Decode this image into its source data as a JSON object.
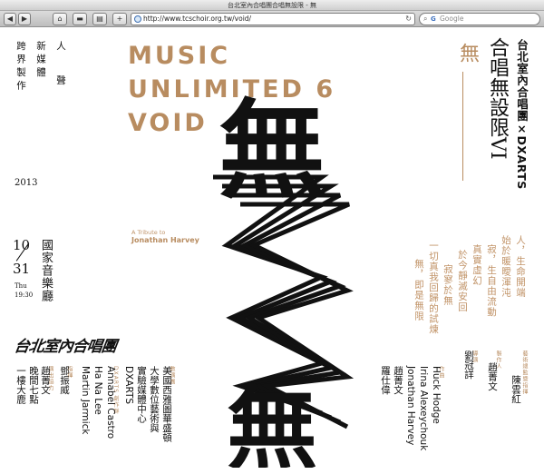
{
  "window": {
    "title": "台北室內合唱團合唱無設限 - 無"
  },
  "toolbar": {
    "back": "◀",
    "forward": "▶",
    "home": "⌂",
    "minimize": "▬",
    "bookmarks": "▤",
    "add": "+",
    "url": "http://www.tcschoir.org.tw/void/",
    "reload": "↻",
    "search_placeholder": "Google",
    "search_brand": "G"
  },
  "poster": {
    "headline_lines": [
      "MUSIC",
      "UNLIMITED 6",
      "VOID"
    ],
    "tribute": "A Tribute to",
    "tribute_name": "Jonathan Harvey",
    "left_verse": [
      "人",
      "新媒體",
      "聲",
      "跨界製作"
    ],
    "year": "2013",
    "date_month": "10",
    "date_day": "31",
    "weekday": "Thu",
    "time": "19:30",
    "venue": "國家音樂廳",
    "choir_logo": "台北室內合唱團",
    "big_char": "無",
    "side_mark": "無",
    "main_title": "合唱無設限VI",
    "presenter": "台北室內合唱團×DXARTS",
    "poem_lines": [
      "人，生命開端",
      "始於暖曖渾沌",
      "寂，生自由流動",
      "真實虛幻",
      "於今靜滅安回",
      "寂寥於無",
      "一切真我回歸的試煉",
      "無，即是無限"
    ]
  },
  "credits": {
    "left": [
      {
        "role": "",
        "names": [
          "一樓大鹿"
        ]
      },
      {
        "role": "",
        "names": [
          "晚間七點"
        ]
      },
      {
        "role": "演出協力",
        "names": [
          "趙菁文"
        ]
      },
      {
        "role": "指揮",
        "names": [
          "鄧振威"
        ]
      },
      {
        "role": "",
        "names": [
          "Martin Jarmick"
        ]
      },
      {
        "role": "",
        "names": [
          "Ha Na Lee"
        ]
      },
      {
        "role": "DXARTS 創作群",
        "names": [
          "Annabel Castro"
        ]
      },
      {
        "role": "",
        "names": [
          "DXARTS"
        ]
      },
      {
        "role": "",
        "names": [
          "實驗媒體中心"
        ]
      },
      {
        "role": "",
        "names": [
          "大學數位藝術與"
        ]
      },
      {
        "role": "數演團",
        "names": [
          "美國西雅圖華盛頓"
        ]
      }
    ],
    "right": [
      {
        "role": "",
        "names": [
          "羅仕偉"
        ]
      },
      {
        "role": "",
        "names": [
          "趙菁文"
        ]
      },
      {
        "role": "",
        "names": [
          "Jonathan Harvey"
        ]
      },
      {
        "role": "",
        "names": [
          "Irina Alexeychouk"
        ]
      },
      {
        "role": "作曲",
        "names": [
          "Huck Hodge"
        ]
      },
      {
        "role": "導演",
        "names": [
          "劉冠詳"
        ]
      },
      {
        "role": "製作人",
        "names": [
          "趙菁文"
        ]
      },
      {
        "role": "藝術總監暨指揮",
        "names": [
          "陳雲紅"
        ]
      }
    ]
  },
  "colors": {
    "accent": "#b88c60",
    "text": "#111111",
    "background": "#ffffff"
  }
}
